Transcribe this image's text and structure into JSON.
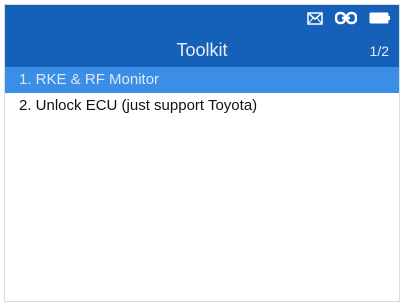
{
  "status_bar": {
    "icons": [
      "mail-icon",
      "link-icon",
      "battery-icon"
    ],
    "background_color": "#1560b8"
  },
  "header": {
    "title": "Toolkit",
    "page_indicator": "1/2"
  },
  "menu": {
    "selected_index": 0,
    "selected_color": "#3b8ee6",
    "items": [
      {
        "label": "1. RKE & RF Monitor"
      },
      {
        "label": "2. Unlock ECU (just support Toyota)"
      }
    ]
  }
}
